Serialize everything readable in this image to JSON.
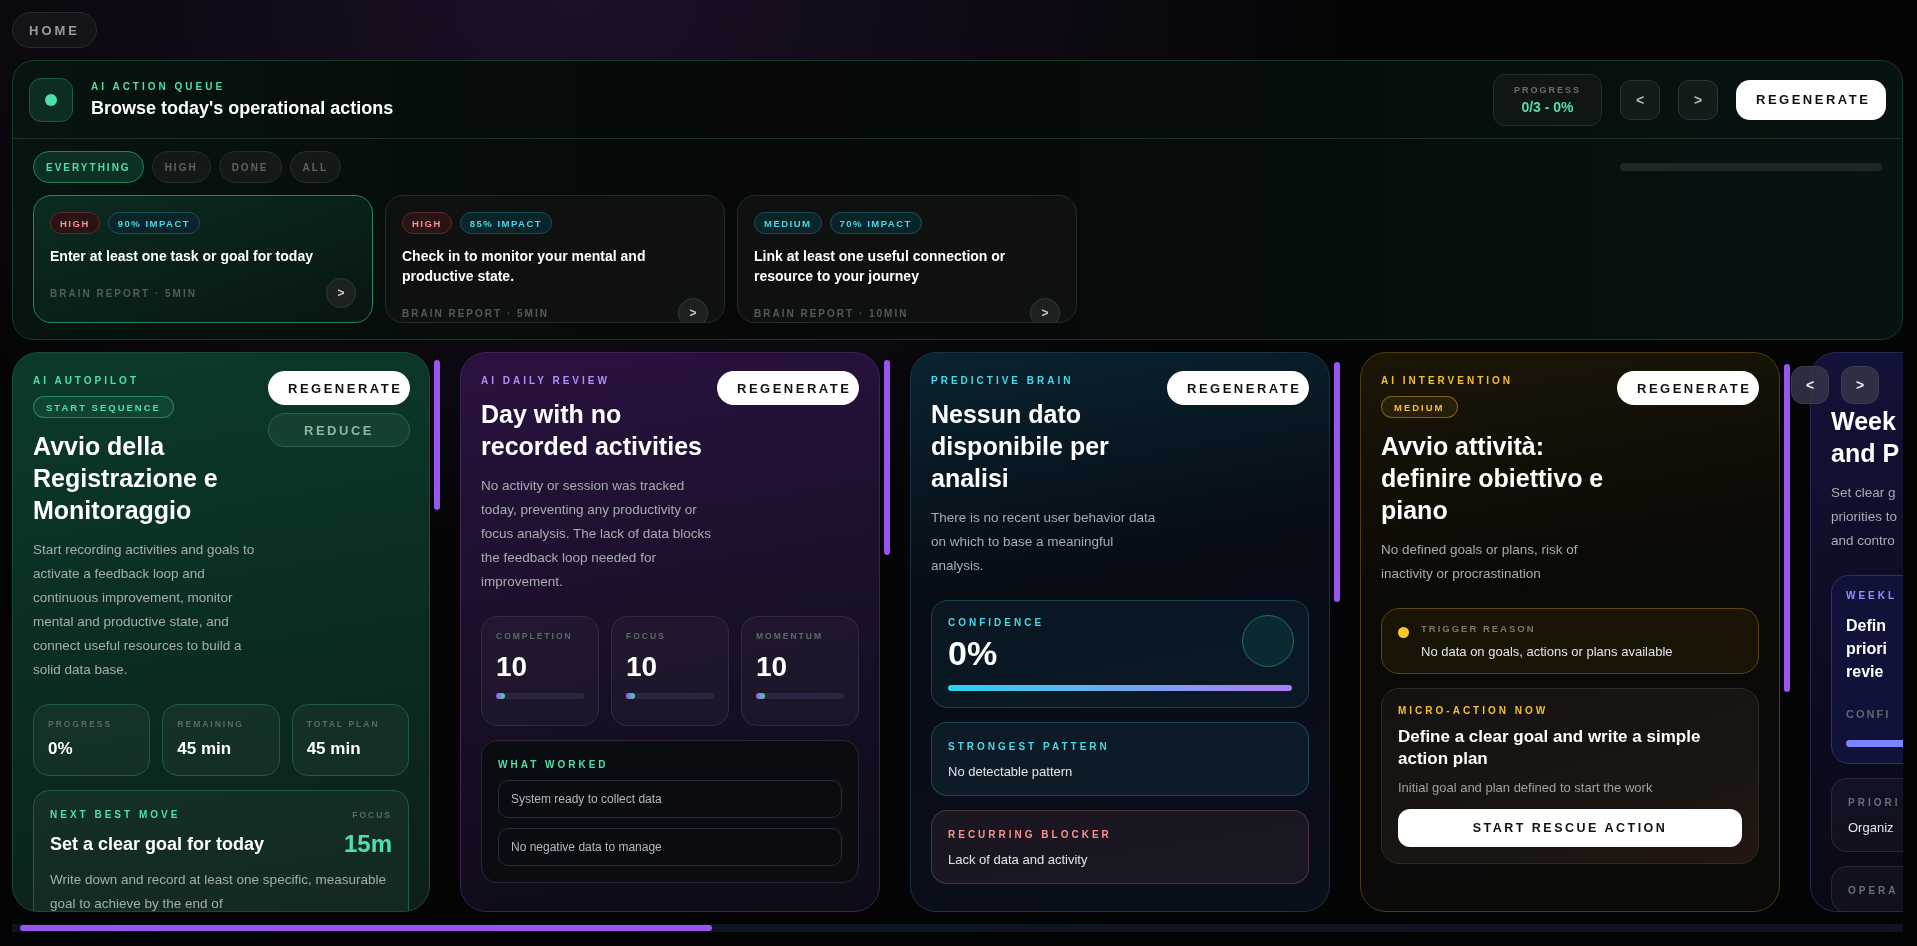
{
  "home": {
    "label": "HOME"
  },
  "queue": {
    "eyebrow": "AI ACTION QUEUE",
    "title": "Browse today's operational actions",
    "progress": {
      "label": "PROGRESS",
      "value": "0/3 - 0%"
    },
    "prev": "<",
    "next": ">",
    "regenerate": "REGENERATE",
    "filters": [
      {
        "label": "EVERYTHING",
        "selected": true
      },
      {
        "label": "HIGH",
        "selected": false
      },
      {
        "label": "DONE",
        "selected": false
      },
      {
        "label": "ALL",
        "selected": false
      }
    ],
    "actions": [
      {
        "priority": {
          "label": "HIGH",
          "kind": "high"
        },
        "impact": "90% IMPACT",
        "text": "Enter at least one task or goal for today",
        "source": "BRAIN REPORT · 5MIN",
        "open": ">",
        "selected": true
      },
      {
        "priority": {
          "label": "HIGH",
          "kind": "high"
        },
        "impact": "85% IMPACT",
        "text": "Check in to monitor your mental and productive state.",
        "source": "BRAIN REPORT · 5MIN",
        "open": ">",
        "selected": false
      },
      {
        "priority": {
          "label": "MEDIUM",
          "kind": "medium"
        },
        "impact": "70% IMPACT",
        "text": "Link at least one useful connection or resource to your journey",
        "source": "BRAIN REPORT · 10MIN",
        "open": ">",
        "selected": false
      }
    ]
  },
  "cards": [
    {
      "kind": "autopilot",
      "eyebrow": "AI AUTOPILOT",
      "badge": "START SEQUENCE",
      "title": [
        "Avvio della Registrazione e Monitoraggio"
      ],
      "description": [
        "Start recording activities and goals to activate a feedback loop and continuous improvement, monitor mental and productive state, and connect useful resources to build a solid data base."
      ],
      "buttons": [
        {
          "label": "REGENERATE",
          "kind": "primary"
        },
        {
          "label": "REDUCE",
          "kind": "secondary"
        }
      ],
      "blocks": [
        {
          "kind": "stats",
          "items": [
            {
              "label": "PROGRESS",
              "value": "0%"
            },
            {
              "label": "REMAINING",
              "value": "45 min"
            },
            {
              "label": "TOTAL PLAN",
              "value": "45 min"
            }
          ]
        },
        {
          "kind": "next_move",
          "eyebrow": "NEXT BEST MOVE",
          "side_label": "FOCUS",
          "title": "Set a clear goal for today",
          "side_value": "15m",
          "description": "Write down and record at least one specific, measurable goal to achieve by the end of"
        }
      ]
    },
    {
      "kind": "review",
      "eyebrow": "AI DAILY REVIEW",
      "title": [
        "Day with no recorded activities"
      ],
      "description": [
        "No activity or session was tracked today, preventing any productivity or focus analysis. The lack of data blocks the feedback loop needed for improvement."
      ],
      "buttons": [
        {
          "label": "REGENERATE",
          "kind": "primary"
        }
      ],
      "blocks": [
        {
          "kind": "metrics",
          "items": [
            {
              "label": "COMPLETION",
              "value": "10",
              "level": 0.1
            },
            {
              "label": "FOCUS",
              "value": "10",
              "level": 0.1
            },
            {
              "label": "MOMENTUM",
              "value": "10",
              "level": 0.1
            }
          ]
        },
        {
          "kind": "list",
          "label": "WHAT WORKED",
          "items": [
            "System ready to collect data",
            "No negative data to manage"
          ]
        }
      ]
    },
    {
      "kind": "predictive",
      "eyebrow": "PREDICTIVE BRAIN",
      "title": [
        "Nessun dato disponibile per analisi"
      ],
      "description": [
        "There is no recent user behavior data on which to base a meaningful analysis."
      ],
      "buttons": [
        {
          "label": "REGENERATE",
          "kind": "primary"
        }
      ],
      "blocks": [
        {
          "kind": "confidence",
          "label": "CONFIDENCE",
          "value": "0%",
          "level": 1
        },
        {
          "kind": "note",
          "color": "#48d8e8",
          "label": "STRONGEST PATTERN",
          "text": "No detectable pattern"
        },
        {
          "kind": "note",
          "color": "#ff8f8f",
          "label": "RECURRING BLOCKER",
          "text": "Lack of data and activity"
        }
      ]
    },
    {
      "kind": "intervention",
      "eyebrow": "AI INTERVENTION",
      "badge": "MEDIUM",
      "title": [
        "Avvio attività: definire obiettivo e piano"
      ],
      "description": [
        "No defined goals or plans, risk of inactivity or procrastination"
      ],
      "buttons": [
        {
          "label": "REGENERATE",
          "kind": "primary"
        }
      ],
      "blocks": [
        {
          "kind": "trigger",
          "label": "TRIGGER REASON",
          "text": "No data on goals, actions or plans available"
        },
        {
          "kind": "micro",
          "eyebrow": "MICRO-ACTION NOW",
          "title": "Define a clear goal and write a simple action plan",
          "description": "Initial goal and plan defined to start the work",
          "button": "START RESCUE ACTION"
        }
      ]
    },
    {
      "kind": "weekly",
      "title": [
        "Week",
        "and P"
      ],
      "description": [
        "Set clear g",
        "priorities to",
        "and contro"
      ],
      "blocks": [
        {
          "kind": "clipped",
          "label": "WEEKL",
          "lines": [
            "Defin",
            "priori",
            "revie"
          ],
          "sub": "CONFI"
        },
        {
          "kind": "note",
          "color": "#6b6d80",
          "label": "PRIORI",
          "text": "Organiz"
        },
        {
          "kind": "note",
          "color": "#6b6d80",
          "label": "OPERA"
        }
      ]
    }
  ],
  "carousel": {
    "prev": "<",
    "next": ">"
  }
}
